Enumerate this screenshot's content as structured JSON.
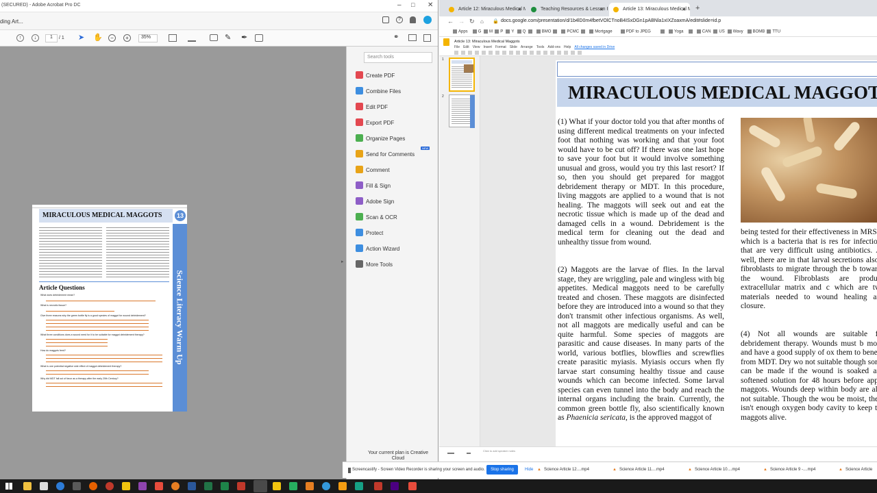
{
  "acrobat": {
    "title": "(SECURED) - Adobe Acrobat Pro DC",
    "tab": "ding Art...",
    "page_current": "1",
    "page_total": "/ 1",
    "zoom": "35%",
    "search_placeholder": "Search tools",
    "tools": [
      {
        "label": "Create PDF",
        "color": "#e34850"
      },
      {
        "label": "Combine Files",
        "color": "#3d8ee0"
      },
      {
        "label": "Edit PDF",
        "color": "#e34850"
      },
      {
        "label": "Export PDF",
        "color": "#e34850"
      },
      {
        "label": "Organize Pages",
        "color": "#4caf50"
      },
      {
        "label": "Send for Comments",
        "color": "#e8a317",
        "badge": "NEW"
      },
      {
        "label": "Comment",
        "color": "#e8a317"
      },
      {
        "label": "Fill & Sign",
        "color": "#8e5ec7"
      },
      {
        "label": "Adobe Sign",
        "color": "#8e5ec7"
      },
      {
        "label": "Scan & OCR",
        "color": "#4caf50"
      },
      {
        "label": "Protect",
        "color": "#3d8ee0"
      },
      {
        "label": "Action Wizard",
        "color": "#3d8ee0"
      },
      {
        "label": "More Tools",
        "color": "#666666"
      }
    ],
    "plan_text": "Your current plan is Creative Cloud",
    "doc": {
      "title": "MIRACULOUS MEDICAL MAGGOTS",
      "number": "13",
      "side_label": "Science Literacy Warm Up",
      "section": "Article Questions",
      "questions": [
        "What does debridement mean?",
        "What is necrotic tissue?",
        "Give three reasons why the green bottle fly is a good species of maggot for wound debridement?",
        "What three conditions does a wound need for it to be suitable for maggot debridement therapy?",
        "How do maggots feed?",
        "What is one potential negative side effect of maggot debridement therapy?",
        "Why did MDT fall out of favor as a therapy after the early 20th Century?"
      ]
    }
  },
  "chrome": {
    "tabs": [
      {
        "label": "Article 12: Miraculous Medical M",
        "active": false
      },
      {
        "label": "Teaching Resources & Lesson Pla",
        "active": false
      },
      {
        "label": "Article 13: Miraculous Medical M",
        "active": true
      }
    ],
    "url": "docs.google.com/presentation/d/1b4lD0m4fbetVOlCTnoB4ISxDGn1pABNla1xIXZoaxmA/edit#slide=id.p",
    "bookmarks": [
      "Apps",
      "G",
      "M",
      "P",
      "Y",
      "Q",
      "",
      "BMO",
      "",
      "PCMC",
      "",
      "Mortgage",
      "PDF to JPEG",
      "",
      "Yoga",
      "",
      "CAN",
      "US",
      "Wavy",
      "BOMB",
      "TTU"
    ],
    "doc_title": "Article 13: Miraculous Medical Maggots",
    "menu": [
      "File",
      "Edit",
      "View",
      "Insert",
      "Format",
      "Slide",
      "Arrange",
      "Tools",
      "Add-ons",
      "Help",
      "All changes saved in Drive"
    ],
    "speaker_notes": "Click to add speaker notes",
    "slide": {
      "title": "MIRACULOUS MEDICAL MAGGOTS",
      "p1": "(1) What if your doctor told you that after months of using different medical treatments on your infected foot that nothing was working and that your foot would have to be cut off? If there was one last hope to save your foot but it would involve something unusual and gross, would you try this last resort? If so, then you should get prepared for maggot debridement therapy or MDT. In this procedure, living maggots are applied to a wound that is not healing. The maggots will seek out and eat the necrotic tissue which is made up of the dead and damaged cells in a wound. Debridement is the medical term for cleaning out the dead and unhealthy tissue from wound.",
      "p2": "(2) Maggots are the larvae of flies. In the larval stage, they are wriggling, pale and wingless with big appetites. Medical maggots need to be carefully treated and chosen. These maggots are disinfected before they are introduced into a wound so that they don't transmit other infectious organisms. As well, not all maggots are medically useful and can be quite harmful. Some species of maggots are parasitic and cause diseases. In many parts of the world, various botflies, blowflies and screwflies create parasitic myiasis. Myiasis occurs when fly larvae start consuming healthy tissue and cause wounds which can become infected. Some larval species can even tunnel into the body and reach the internal organs including the brain. Currently, the common green bottle fly, also scientifically known as",
      "p2_italic": "Phaenicia sericata",
      "p2_end": ", is the approved maggot of",
      "p3": "being tested for their effectiveness in MRSA, which is a bacteria that is res for infections that are very difficult using antibiotics. As well, there are in that larval secretions also e fibroblasts to migrate through the b towards the wound. Fibroblasts are produce extracellular matrix and c which are two materials needed to wound healing and closure.",
      "p4": "(4) Not all wounds are suitable for debridement therapy. Wounds must b moist and have a good supply of ox them to benefit from MDT. Dry wo not suitable though some can be made if the wound is soaked and softened solution for 48 hours before apply maggots. Wounds deep within body are also not suitable. Though the wou be moist, there isn't enough oxygen body cavity to keep the maggots alive."
    }
  },
  "sharebar": {
    "message": "Screencastify - Screen Video Recorder is sharing your screen and audio.",
    "stop": "Stop sharing",
    "hide": "Hide",
    "downloads": [
      "Science Article 12....mp4",
      "Science Article 11....mp4",
      "Science Article 10....mp4",
      "Science Article 9 -....mp4",
      "Science Article"
    ]
  }
}
